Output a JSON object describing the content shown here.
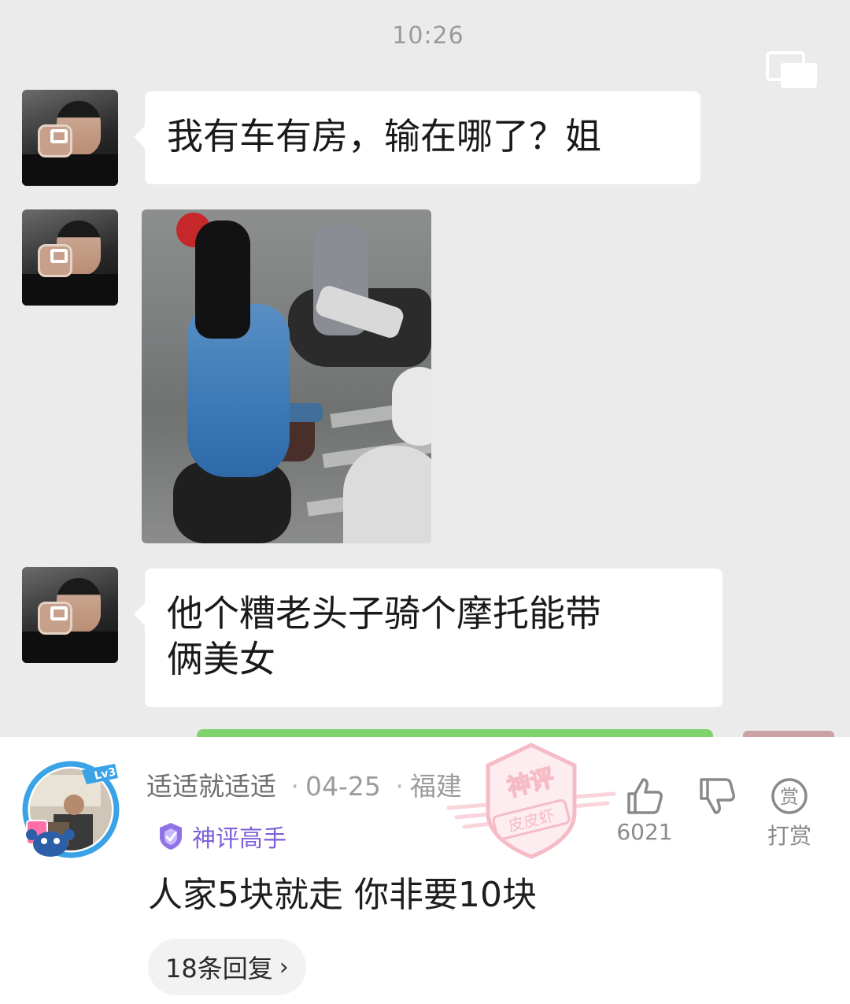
{
  "chat": {
    "time": "10:26",
    "messages": [
      {
        "type": "text",
        "text": "我有车有房，输在哪了？姐"
      },
      {
        "type": "image"
      },
      {
        "type": "text",
        "line1": "他个糟老头子骑个摩托能带",
        "line2": "俩美女"
      }
    ]
  },
  "comment": {
    "username": "适适就适适",
    "date": "04-25",
    "location": "福建",
    "level": "Lv3",
    "badge": "神评高手",
    "text": "人家5块就走 你非要10块",
    "replies": "18条回复",
    "like_count": "6021",
    "tip_icon_char": "赏",
    "tip_label": "打赏",
    "stamp_top": "神评",
    "stamp_bottom": "皮皮虾",
    "colors": {
      "badge": "#7d5fd8",
      "stamp": "#f2a6b4",
      "level_ring": "#3aa3e6"
    }
  }
}
